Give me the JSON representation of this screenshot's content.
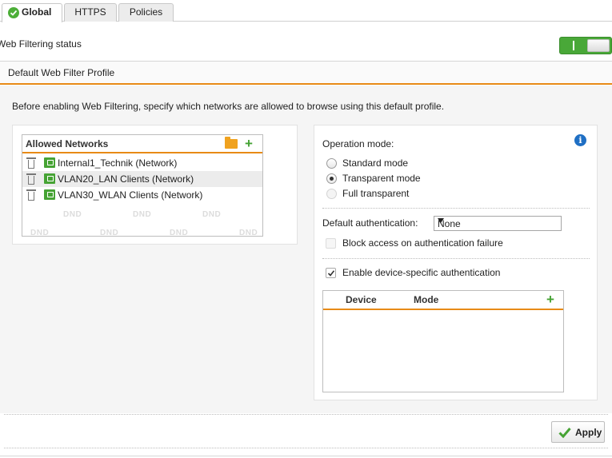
{
  "tabs": [
    {
      "label": "Global",
      "active": true,
      "icon": "check-circle-icon"
    },
    {
      "label": "HTTPS",
      "active": false
    },
    {
      "label": "Policies",
      "active": false
    }
  ],
  "status": {
    "label": "Web Filtering status",
    "enabled": true,
    "toggle_mark": "I"
  },
  "profile": {
    "title": "Default Web Filter Profile"
  },
  "intro_text": "Before enabling Web Filtering, specify which networks are allowed to browse using this default profile.",
  "networks": {
    "title": "Allowed Networks",
    "items": [
      {
        "label": "Internal1_Technik (Network)"
      },
      {
        "label": "VLAN20_LAN Clients (Network)"
      },
      {
        "label": "VLAN30_WLAN Clients (Network)"
      }
    ],
    "placeholder": "DND"
  },
  "operation": {
    "label": "Operation mode:",
    "options": [
      {
        "label": "Standard mode",
        "checked": false,
        "disabled": false
      },
      {
        "label": "Transparent mode",
        "checked": true,
        "disabled": false
      },
      {
        "label": "Full transparent",
        "checked": false,
        "disabled": true
      }
    ]
  },
  "auth": {
    "label": "Default authentication:",
    "value": "None",
    "block_label": "Block access on authentication failure",
    "block_checked": false,
    "device_label": "Enable device-specific authentication",
    "device_checked": true
  },
  "device_table": {
    "columns": [
      "Device",
      "Mode"
    ]
  },
  "footer": {
    "apply_label": "Apply"
  },
  "colors": {
    "accent": "#e88a16",
    "green": "#46a334",
    "info": "#1f6fc4"
  }
}
